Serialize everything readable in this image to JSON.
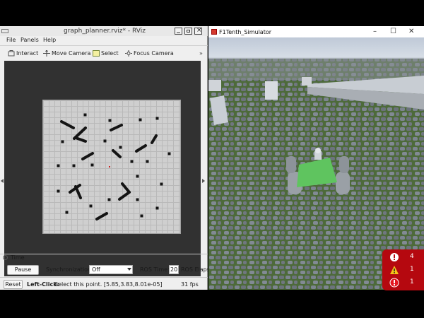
{
  "rviz": {
    "title": "graph_planner.rviz* - RViz",
    "menu": [
      "File",
      "Panels",
      "Help"
    ],
    "toolbar": {
      "interact": "Interact",
      "move_camera": "Move Camera",
      "select": "Select",
      "focus_camera": "Focus Camera",
      "more": "»"
    },
    "time_panel": {
      "title": "Time",
      "pause_label": "Pause",
      "sync_label": "Synchronization:",
      "sync_value": "Off",
      "ros_time_label": "ROS Time:",
      "ros_time_value": "20",
      "ros_elapsed_label": "ROS Elaps"
    },
    "status": {
      "reset_label": "Reset",
      "hint_bold": "Left-Click:",
      "hint_text": "Select this point. [5.85,3.83,8.01e-05]",
      "fps": "31 fps"
    }
  },
  "sim": {
    "title": "F1Tenth_Simulator",
    "controls": [
      "–",
      "☐",
      "✕"
    ],
    "vehicle_color": "#5fc45f",
    "diagnostics": [
      {
        "icon": "error-icon",
        "count": "4"
      },
      {
        "icon": "warning-icon",
        "count": "1"
      },
      {
        "icon": "critical-icon",
        "count": "1"
      }
    ]
  },
  "colors": {
    "diag_bg": "#b5080f",
    "map_bg": "#cfcfcf",
    "obstacle": "#141414"
  }
}
